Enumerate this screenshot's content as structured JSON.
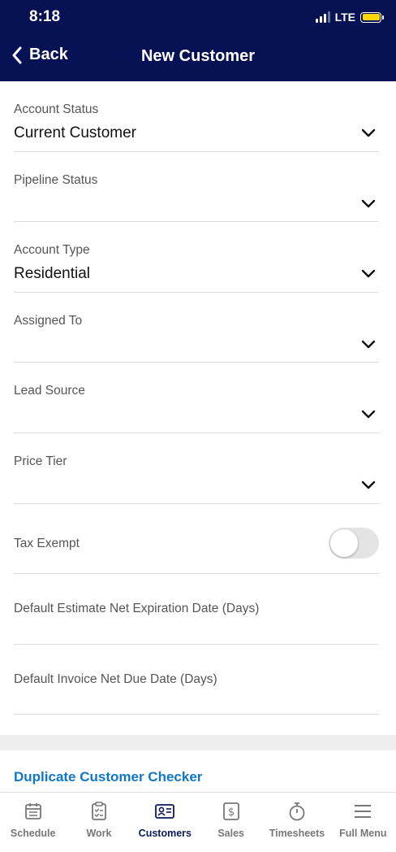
{
  "status_bar": {
    "time": "8:18",
    "network": "LTE"
  },
  "header": {
    "back_label": "Back",
    "title": "New Customer"
  },
  "fields": [
    {
      "label": "Account Status",
      "value": "Current Customer",
      "type": "select"
    },
    {
      "label": "Pipeline Status",
      "value": "",
      "type": "select"
    },
    {
      "label": "Account Type",
      "value": "Residential",
      "type": "select"
    },
    {
      "label": "Assigned To",
      "value": "",
      "type": "select"
    },
    {
      "label": "Lead Source",
      "value": "",
      "type": "select"
    },
    {
      "label": "Price Tier",
      "value": "",
      "type": "select"
    }
  ],
  "tax_exempt": {
    "label": "Tax Exempt",
    "on": false
  },
  "text_fields": [
    {
      "label": "Default Estimate Net Expiration Date (Days)",
      "value": ""
    },
    {
      "label": "Default Invoice Net Due Date (Days)",
      "value": ""
    }
  ],
  "duplicate_checker": {
    "label": "Duplicate Customer Checker"
  },
  "tabbar": {
    "items": [
      {
        "label": "Schedule",
        "icon": "calendar-icon"
      },
      {
        "label": "Work",
        "icon": "clipboard-icon"
      },
      {
        "label": "Customers",
        "icon": "contact-card-icon",
        "active": true
      },
      {
        "label": "Sales",
        "icon": "dollar-icon"
      },
      {
        "label": "Timesheets",
        "icon": "stopwatch-icon"
      },
      {
        "label": "Full Menu",
        "icon": "menu-icon"
      }
    ]
  },
  "colors": {
    "header_bg": "#071255",
    "link": "#1077c8",
    "active_tab": "#0b1a5c",
    "inactive_tab": "#777777"
  }
}
